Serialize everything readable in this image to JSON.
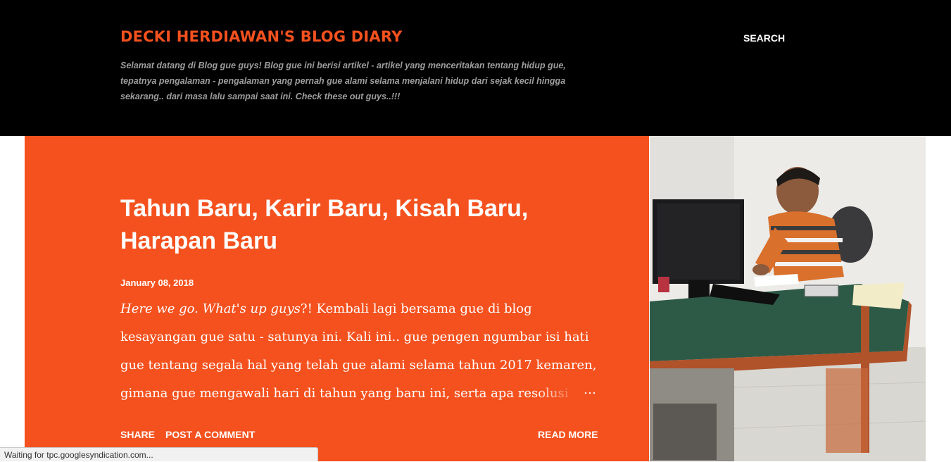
{
  "header": {
    "title": "DECKI HERDIAWAN'S BLOG DIARY",
    "description": "Selamat datang di Blog gue guys! Blog gue ini berisi artikel - artikel yang menceritakan tentang hidup gue, tepatnya pengalaman - pengalaman yang pernah gue alami selama menjalani hidup dari sejak kecil hingga sekarang.. dari masa lalu sampai saat ini. Check these out guys..!!!",
    "search_label": "SEARCH"
  },
  "post": {
    "title": "Tahun Baru, Karir Baru, Kisah Baru, Harapan Baru",
    "date": "January 08, 2018",
    "snippet_italic": "Here we go. What's up guys",
    "snippet_rest": "?! Kembali lagi bersama gue di blog kesayangan gue satu - satunya ini. Kali ini.. gue pengen ngumbar isi hati gue tentang segala hal yang telah gue alami selama tahun 2017 kemaren, gimana gue mengawali hari di tahun yang baru ini, serta apa resolusi",
    "ellipsis": "…",
    "share_label": "SHARE",
    "comment_label": "POST A COMMENT",
    "read_more_label": "READ MORE"
  },
  "status": {
    "text": "Waiting for tpc.googlesyndication.com..."
  },
  "colors": {
    "accent": "#f4511e",
    "header_bg": "#000000"
  }
}
